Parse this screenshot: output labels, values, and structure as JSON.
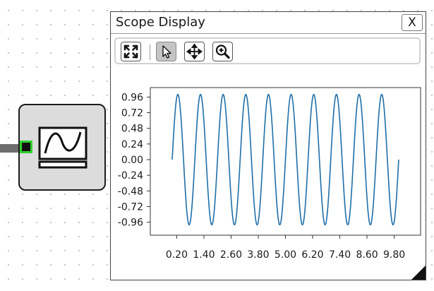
{
  "window": {
    "title": "Scope Display",
    "close_label": "X"
  },
  "toolbar": {
    "buttons": [
      {
        "icon": "fit-view-icon",
        "active": false
      },
      {
        "icon": "pointer-icon",
        "active": true
      },
      {
        "icon": "pan-icon",
        "active": false
      },
      {
        "icon": "zoom-icon",
        "active": false
      }
    ]
  },
  "colors": {
    "trace": "#1f6fa8",
    "port": "#2ed12e",
    "block_bg": "#dcdcdc"
  },
  "chart_data": {
    "type": "line",
    "title": "",
    "xlabel": "",
    "ylabel": "",
    "xlim": [
      0.0,
      10.0
    ],
    "ylim": [
      -1.04,
      1.04
    ],
    "x_ticks": [
      0.2,
      1.4,
      2.6,
      3.8,
      5.0,
      6.2,
      7.4,
      8.6,
      9.8
    ],
    "x_tick_labels": [
      "0.20",
      "1.40",
      "2.60",
      "3.80",
      "5.00",
      "6.20",
      "7.40",
      "8.60",
      "9.80"
    ],
    "y_ticks": [
      0.96,
      0.72,
      0.48,
      0.24,
      0.0,
      -0.24,
      -0.48,
      -0.72,
      -0.96
    ],
    "y_tick_labels": [
      "0.96",
      "0.72",
      "0.48",
      "0.24",
      "0.00",
      "-0.24",
      "-0.48",
      "-0.72",
      "-0.96"
    ],
    "grid": false,
    "series": [
      {
        "color": "#1f6fa8",
        "function": "sin",
        "amplitude": 1.0,
        "cycles": 10,
        "x_start": 0.0,
        "x_end": 10.0
      }
    ]
  }
}
